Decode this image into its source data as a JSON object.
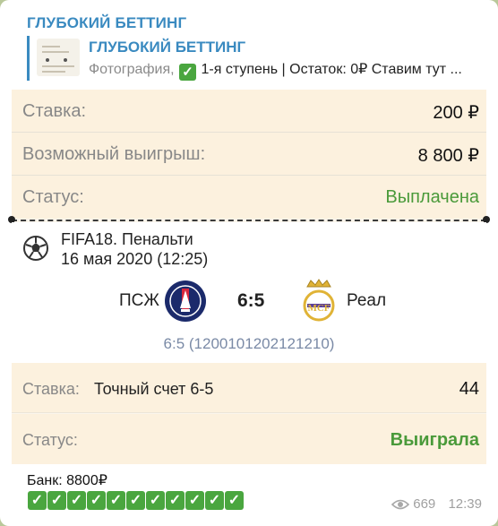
{
  "message": {
    "sender": "ГЛУБОКИЙ БЕТТИНГ",
    "reply": {
      "title": "ГЛУБОКИЙ БЕТТИНГ",
      "media_label": "Фотография,",
      "text": "1-я ступень | Остаток: 0₽  Ставим тут ..."
    },
    "bet_card": {
      "stake_label": "Ставка:",
      "stake_value": "200 ₽",
      "win_label": "Возможный выигрыш:",
      "win_value": "8 800 ₽",
      "status_label": "Статус:",
      "status_value": "Выплачена",
      "match_title": "FIFA18. Пенальти",
      "match_date": "16 мая 2020 (12:25)",
      "team1": "ПСЖ",
      "score": "6:5",
      "team2": "Реал",
      "score_detail": "6:5 (1200101202121210)",
      "bet_label": "Ставка:",
      "bet_type": "Точный счет 6-5",
      "bet_odds": "44",
      "result_label": "Статус:",
      "result_value": "Выиграла"
    },
    "caption": "Банк: 8800₽",
    "check_count": 11,
    "views": "669",
    "time": "12:39"
  },
  "colors": {
    "accent": "#3a8ac0",
    "status_green": "#4a9a3a",
    "check_green": "#4aa63f",
    "card_bg": "#fcf1de"
  },
  "icons": [
    "check-icon",
    "soccer-ball-icon",
    "psg-logo",
    "real-madrid-logo",
    "eye-icon"
  ]
}
